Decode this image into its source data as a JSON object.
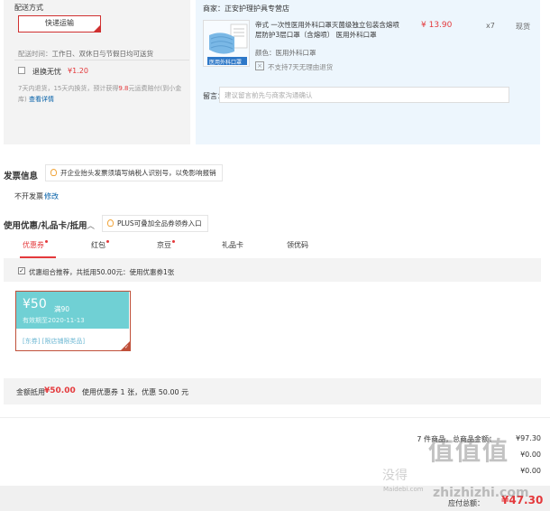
{
  "delivery": {
    "title": "配送方式",
    "method_button": "快递运输",
    "time_label": "配送时间：",
    "time_value": "工作日、双休日与节假日均可送货",
    "return_label": "退换无忧",
    "return_price": "¥1.20",
    "desc_pre": "7天内退货，15天内换货，预计获得",
    "desc_hl": "9.8",
    "desc_post": "元运费赔付(到小金库)",
    "desc_link": "查看详情"
  },
  "merchant": {
    "seller_label": "商家：",
    "seller_name": "正安护理护具专营店",
    "product_name": "帝式 一次性医用外科口罩灭菌级独立包装含熔喷层防护3层口罩（含熔喷） 医用外科口罩",
    "product_img_caption": "医用外科口罩",
    "price": "¥ 13.90",
    "qty": "x7",
    "stock": "现货",
    "color_label": "颜色：",
    "color_value": "医用外科口罩",
    "no_return": "不支持7天无理由退货",
    "note_label": "留言：",
    "note_placeholder": "建议留言前先与商家沟通确认"
  },
  "invoice": {
    "title": "发票信息",
    "tip": "开企业抬头发票须填写纳税人识别号，以免影响报销",
    "value": "不开发票",
    "edit": "修改"
  },
  "coupons": {
    "title": "使用优惠/礼品卡/抵用",
    "plus_tip": "PLUS可叠加全品券领券入口",
    "tabs": [
      {
        "label": "优惠券",
        "dot": true
      },
      {
        "label": "红包",
        "dot": true
      },
      {
        "label": "京豆",
        "dot": true
      },
      {
        "label": "礼品卡",
        "dot": false
      },
      {
        "label": "领优码",
        "dot": false
      }
    ],
    "combo_text": "优惠组合推荐，共抵用50.00元：使用优惠券1张",
    "card": {
      "amount": "¥50",
      "condition": "满90",
      "expiry": "有效期至2020-11-13",
      "tags": "[东券] [限店铺限类品]"
    },
    "discount_label": "金额抵用",
    "discount_value": "¥50.00",
    "discount_desc": "使用优惠券 1 张，优惠 50.00 元"
  },
  "summary": {
    "items_label": "7 件商品，总商品金额：",
    "items_value": "¥97.30",
    "row2_value": "¥0.00",
    "row3_value": "¥0.00",
    "payable_label": "应付总额：",
    "payable_value": "¥47.30"
  },
  "watermark": {
    "big": "值值值",
    "small": "没得",
    "url": "Maidebi.com",
    "url2": "zhizhizhi.com"
  },
  "colors": {
    "accent": "#e4393c",
    "link": "#005ea7",
    "coupon": "#70d0d4"
  }
}
